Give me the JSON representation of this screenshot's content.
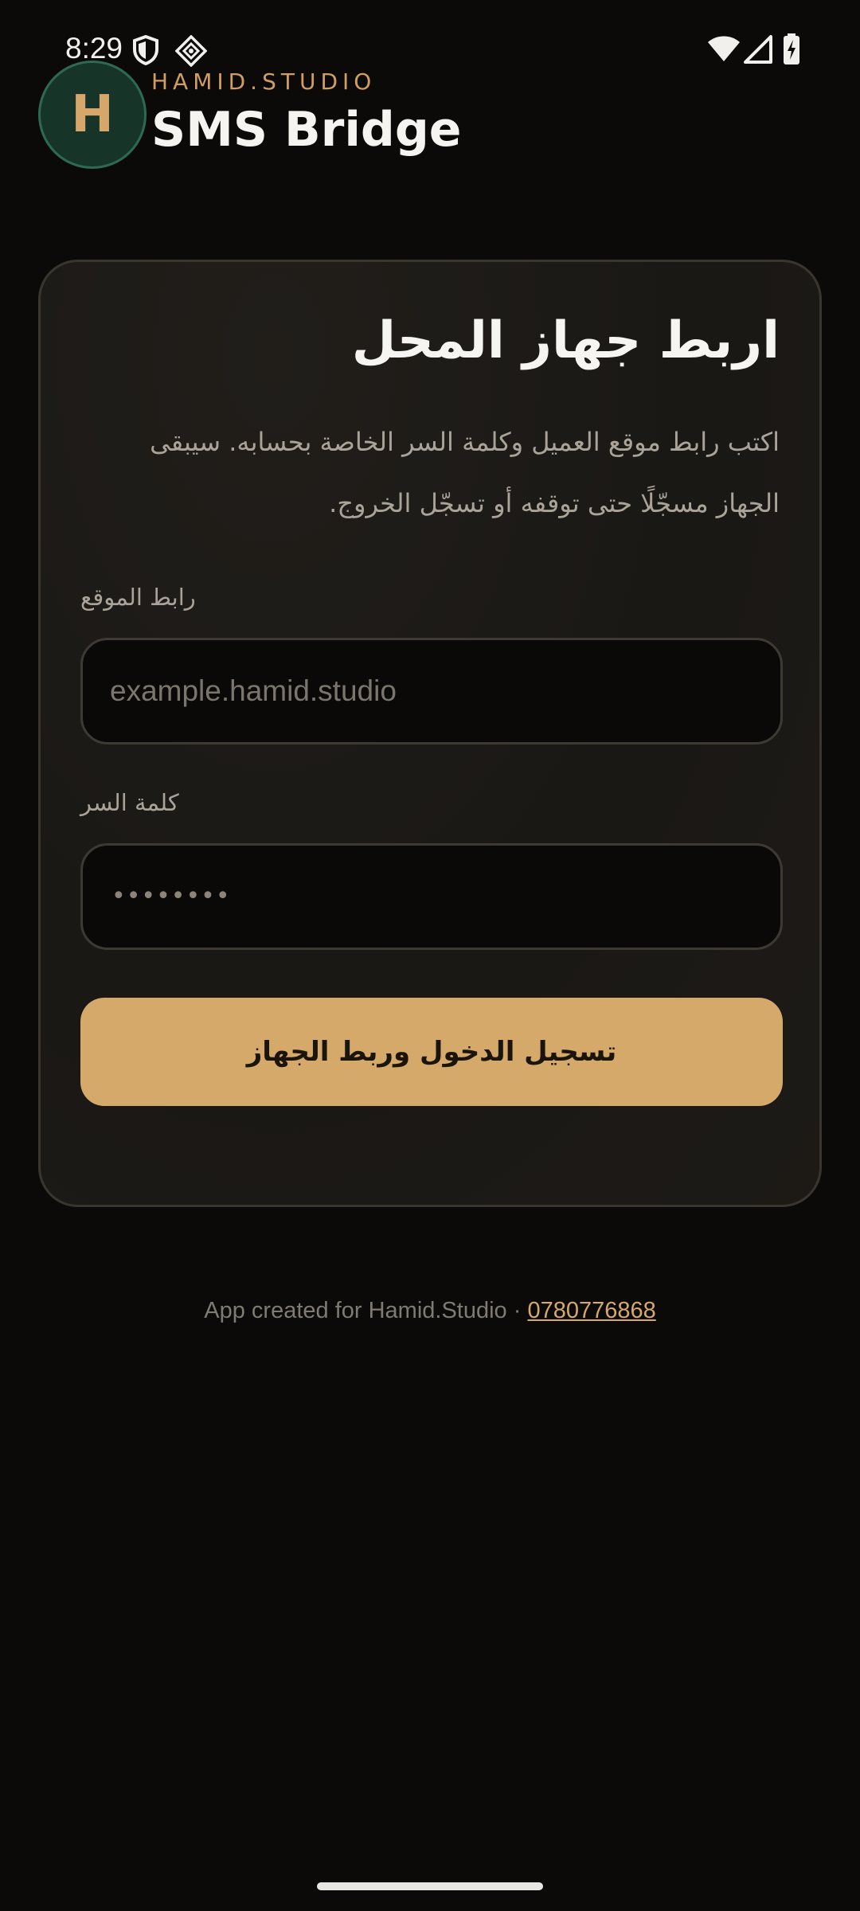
{
  "status_bar": {
    "time": "8:29"
  },
  "header": {
    "avatar_letter": "H",
    "brand_caption": "HAMID.STUDIO",
    "app_title": "SMS Bridge"
  },
  "card": {
    "title": "اربط جهاز المحل",
    "description": "اكتب رابط موقع العميل وكلمة السر الخاصة بحسابه. سيبقى الجهاز مسجّلًا حتى توقفه أو تسجّل الخروج.",
    "site_field": {
      "label": "رابط الموقع",
      "placeholder": "example.hamid.studio",
      "value": ""
    },
    "password_field": {
      "label": "كلمة السر",
      "masked_value": "••••••••"
    },
    "submit_label": "تسجيل الدخول وربط الجهاز"
  },
  "footer": {
    "credit": "App created for Hamid.Studio · ",
    "phone": "0780776868"
  },
  "colors": {
    "background": "#0b0a09",
    "accent": "#d4a96a",
    "avatar_bg": "#163428"
  },
  "icons": [
    "shield-icon",
    "diamond-pattern-icon",
    "wifi-icon",
    "cell-signal-icon",
    "battery-charging-icon"
  ]
}
